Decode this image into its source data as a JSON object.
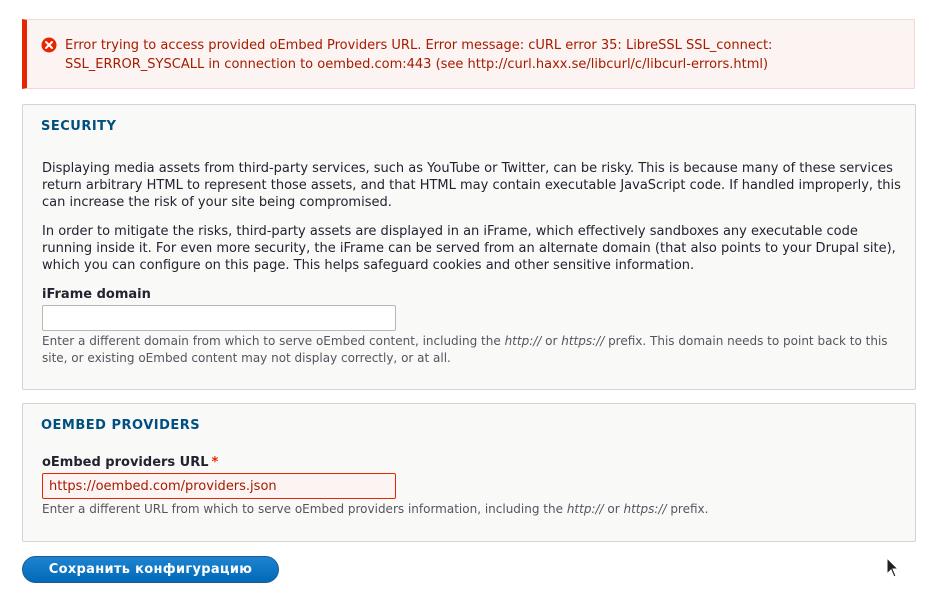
{
  "error": {
    "icon": "error-circle-icon",
    "color": "#e62600",
    "message": "Error trying to access provided oEmbed Providers URL. Error message: cURL error 35: LibreSSL SSL_connect: SSL_ERROR_SYSCALL in connection to oembed.com:443 (see http://curl.haxx.se/libcurl/c/libcurl-errors.html)"
  },
  "security": {
    "legend": "SECURITY",
    "paragraph1": "Displaying media assets from third-party services, such as YouTube or Twitter, can be risky. This is because many of these services return arbitrary HTML to represent those assets, and that HTML may contain executable JavaScript code. If handled improperly, this can increase the risk of your site being compromised.",
    "paragraph2": "In order to mitigate the risks, third-party assets are displayed in an iFrame, which effectively sandboxes any executable code running inside it. For even more security, the iFrame can be served from an alternate domain (that also points to your Drupal site), which you can configure on this page. This helps safeguard cookies and other sensitive information.",
    "iframe_label": "iFrame domain",
    "iframe_value": "",
    "iframe_desc_before": "Enter a different domain from which to serve oEmbed content, including the ",
    "iframe_desc_http": "http://",
    "iframe_desc_or": " or ",
    "iframe_desc_https": "https://",
    "iframe_desc_after": " prefix. This domain needs to point back to this site, or existing oEmbed content may not display correctly, or at all."
  },
  "providers": {
    "legend": "OEMBED PROVIDERS",
    "url_label": "oEmbed providers URL",
    "required_mark": "*",
    "url_value": "https://oembed.com/providers.json",
    "desc_before": "Enter a different URL from which to serve oEmbed providers information, including the ",
    "desc_http": "http://",
    "desc_or": " or ",
    "desc_https": "https://",
    "desc_after": " prefix."
  },
  "actions": {
    "save_label": "Сохранить конфигурацию",
    "accent": "#0069b8"
  }
}
